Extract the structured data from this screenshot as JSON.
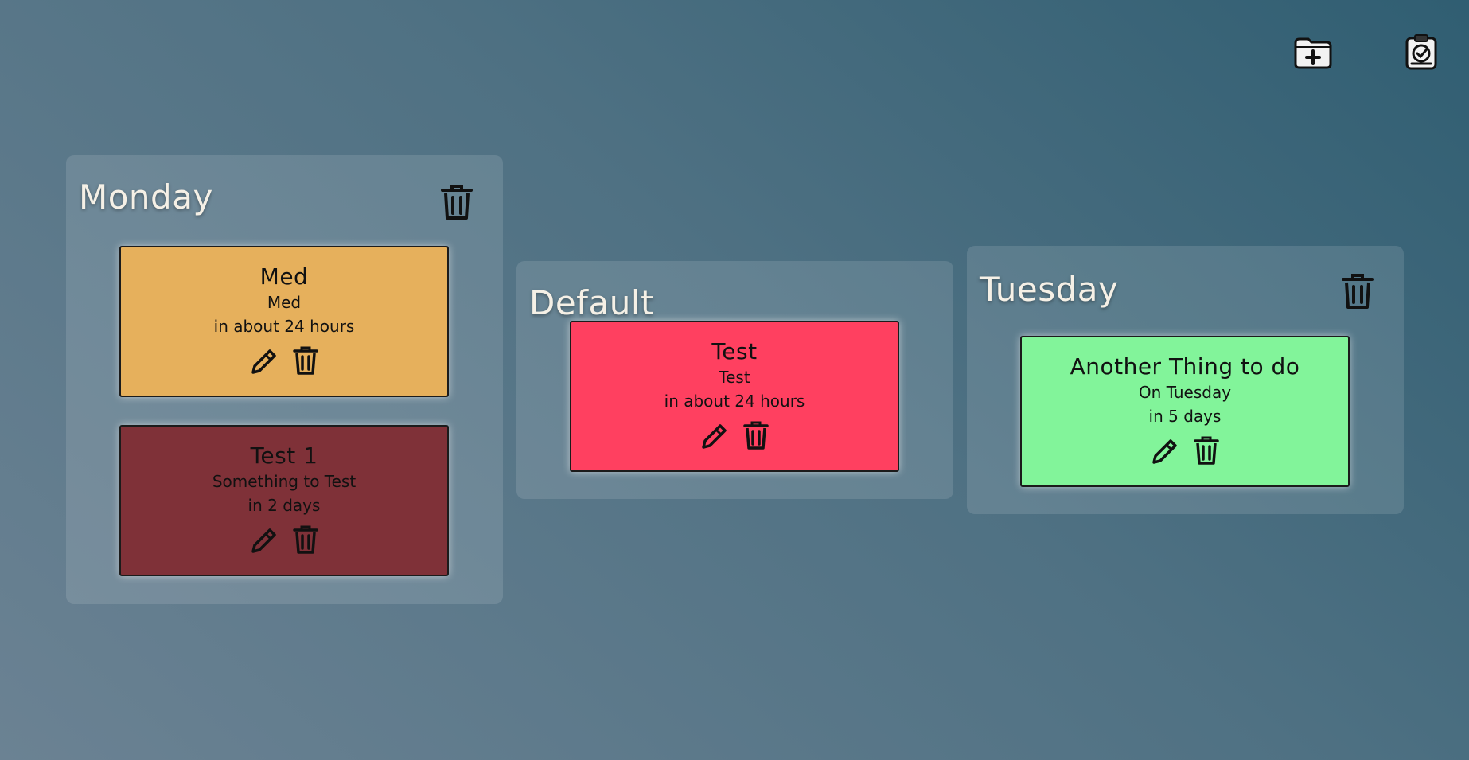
{
  "toolbar": {
    "add_folder_icon": "folder-plus-icon",
    "save_icon": "clipboard-save-icon"
  },
  "groups": [
    {
      "title": "Monday",
      "cards": [
        {
          "title": "Med",
          "description": "Med",
          "due": "in about 24 hours",
          "color": "#e6b05c"
        },
        {
          "title": "Test 1",
          "description": "Something to Test",
          "due": "in 2 days",
          "color": "#7f3138"
        }
      ]
    },
    {
      "title": "Default",
      "cards": [
        {
          "title": "Test",
          "description": "Test",
          "due": "in about 24 hours",
          "color": "#ff4060"
        }
      ]
    },
    {
      "title": "Tuesday",
      "cards": [
        {
          "title": "Another Thing to do",
          "description": "On Tuesday",
          "due": "in 5 days",
          "color": "#82f49a"
        }
      ]
    }
  ]
}
